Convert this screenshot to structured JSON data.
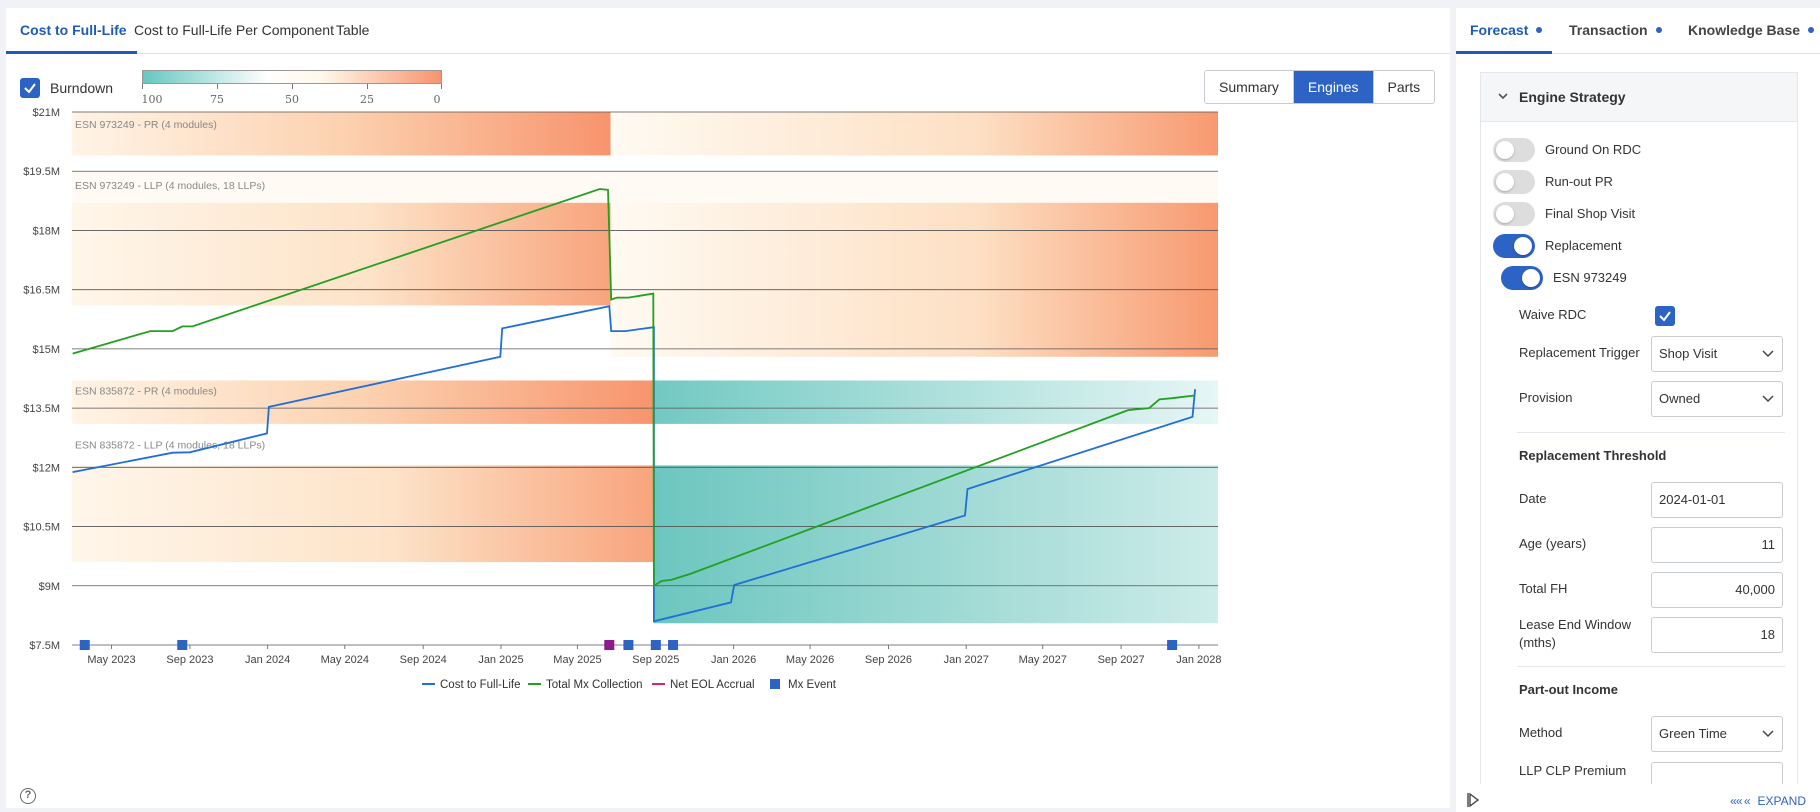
{
  "tabs": [
    "Cost to Full-Life",
    "Cost to Full-Life Per Component",
    "Table"
  ],
  "burndown": {
    "label": "Burndown",
    "checked": true
  },
  "scale_legend": {
    "ticks": [
      "100",
      "75",
      "50",
      "25",
      "0"
    ],
    "colors": [
      "#66c7c0",
      "#ffffff",
      "#f7946d"
    ]
  },
  "view_toggle": {
    "options": [
      "Summary",
      "Engines",
      "Parts"
    ],
    "selected": "Engines"
  },
  "chart_data": {
    "type": "line",
    "y_ticks": [
      "$21M",
      "$19.5M",
      "$18M",
      "$16.5M",
      "$15M",
      "$13.5M",
      "$12M",
      "$10.5M",
      "$9M",
      "$7.5M"
    ],
    "ylim": [
      7.5,
      21
    ],
    "x_ticks": [
      "May 2023",
      "Sep 2023",
      "Jan 2024",
      "May 2024",
      "Sep 2024",
      "Jan 2025",
      "May 2025",
      "Sep 2025",
      "Jan 2026",
      "May 2026",
      "Sep 2026",
      "Jan 2027",
      "May 2027",
      "Sep 2027",
      "Jan 2028"
    ],
    "bands": [
      {
        "label": "ESN 973249 - PR (4 modules)"
      },
      {
        "label": "ESN 973249 - LLP (4 modules, 18 LLPs)"
      },
      {
        "label": "ESN 835872 - PR (4 modules)"
      },
      {
        "label": "ESN 835872 - LLP (4 modules, 18 LLPs)"
      }
    ],
    "series": [
      {
        "name": "Cost to Full-Life",
        "color": "#1f6fd6",
        "points": [
          [
            "2023-03-01",
            11.88
          ],
          [
            "2023-08-05",
            12.37
          ],
          [
            "2023-09-01",
            12.38
          ],
          [
            "2023-12-31",
            12.86
          ],
          [
            "2024-01-03",
            13.53
          ],
          [
            "2024-12-31",
            14.8
          ],
          [
            "2025-01-03",
            15.52
          ],
          [
            "2025-06-20",
            16.08
          ],
          [
            "2025-06-23",
            15.45
          ],
          [
            "2025-07-15",
            15.45
          ],
          [
            "2025-08-29",
            15.55
          ],
          [
            "2025-08-29",
            8.1
          ],
          [
            "2025-12-28",
            8.58
          ],
          [
            "2026-01-02",
            9.02
          ],
          [
            "2026-12-30",
            10.78
          ],
          [
            "2027-01-03",
            11.45
          ],
          [
            "2027-12-22",
            13.28
          ],
          [
            "2027-12-26",
            13.98
          ]
        ]
      },
      {
        "name": "Total Mx Collection",
        "color": "#22a020",
        "points": [
          [
            "2023-03-01",
            14.88
          ],
          [
            "2023-07-01",
            15.45
          ],
          [
            "2023-08-05",
            15.45
          ],
          [
            "2023-08-20",
            15.57
          ],
          [
            "2023-09-05",
            15.57
          ],
          [
            "2025-06-05",
            19.05
          ],
          [
            "2025-06-18",
            19.03
          ],
          [
            "2025-06-23",
            16.25
          ],
          [
            "2025-07-02",
            16.3
          ],
          [
            "2025-07-20",
            16.3
          ],
          [
            "2025-08-28",
            16.4
          ],
          [
            "2025-08-29",
            9.0
          ],
          [
            "2025-09-10",
            9.12
          ],
          [
            "2025-09-25",
            9.15
          ],
          [
            "2025-10-25",
            9.3
          ],
          [
            "2027-09-12",
            13.45
          ],
          [
            "2027-10-15",
            13.5
          ],
          [
            "2027-10-31",
            13.72
          ],
          [
            "2027-11-20",
            13.75
          ],
          [
            "2027-12-25",
            13.82
          ]
        ]
      },
      {
        "name": "Net EOL Accrual",
        "color": "#d6246e",
        "points": []
      },
      {
        "name": "Mx Event",
        "color": "#2c63c4",
        "marker": "square",
        "events": [
          "2023-03-20",
          "2023-08-20",
          "2025-06-20",
          "2025-07-20",
          "2025-09-01",
          "2025-09-28",
          "2027-11-20"
        ],
        "highlight_event": "2025-06-20",
        "highlight_color": "#8b1a8b"
      }
    ],
    "legend": [
      "Cost to Full-Life",
      "Total Mx Collection",
      "Net EOL Accrual",
      "Mx Event"
    ],
    "grid": true,
    "legend_placement": "bottom-center"
  },
  "right_tabs": [
    "Forecast",
    "Transaction",
    "Knowledge Base"
  ],
  "strategy": {
    "title": "Engine Strategy",
    "toggles": [
      {
        "label": "Ground On RDC",
        "on": false
      },
      {
        "label": "Run-out PR",
        "on": false
      },
      {
        "label": "Final Shop Visit",
        "on": false
      },
      {
        "label": "Replacement",
        "on": true
      }
    ],
    "engine_toggle": {
      "label": "ESN 973249",
      "on": true
    },
    "waive_rdc": {
      "label": "Waive RDC",
      "checked": true
    },
    "replacement_trigger": {
      "label": "Replacement Trigger",
      "value": "Shop Visit"
    },
    "provision": {
      "label": "Provision",
      "value": "Owned"
    },
    "threshold": {
      "title": "Replacement Threshold",
      "date": {
        "label": "Date",
        "value": "2024-01-01"
      },
      "age": {
        "label": "Age (years)",
        "value": "11"
      },
      "total_fh": {
        "label": "Total FH",
        "value": "40,000"
      },
      "lease_end": {
        "label": "Lease End Window (mths)",
        "value": "18"
      }
    },
    "partout": {
      "title": "Part-out Income",
      "method": {
        "label": "Method",
        "value": "Green Time"
      },
      "llp_clp": {
        "label": "LLP CLP Premium",
        "value": ""
      }
    }
  },
  "expand_label": "EXPAND",
  "help_glyph": "?"
}
